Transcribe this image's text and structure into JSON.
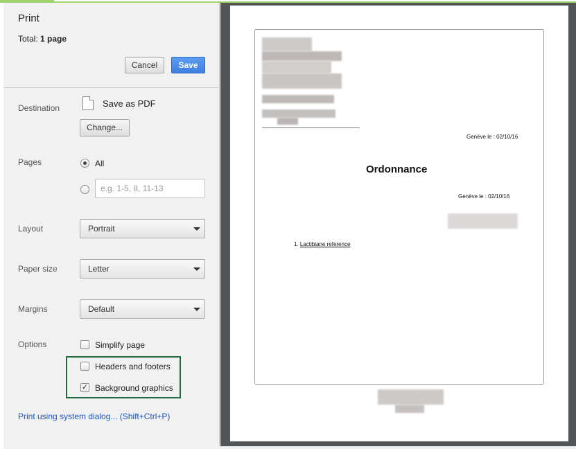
{
  "header": {
    "title": "Print",
    "total_prefix": "Total: ",
    "total_value": "1 page",
    "cancel_label": "Cancel",
    "save_label": "Save"
  },
  "destination": {
    "label": "Destination",
    "name": "Save as PDF",
    "change_label": "Change..."
  },
  "pages": {
    "label": "Pages",
    "all_label": "All",
    "range_placeholder": "e.g. 1-5, 8, 11-13",
    "selected": "All"
  },
  "layout": {
    "label": "Layout",
    "value": "Portrait"
  },
  "paper_size": {
    "label": "Paper size",
    "value": "Letter"
  },
  "margins": {
    "label": "Margins",
    "value": "Default"
  },
  "options": {
    "label": "Options",
    "simplify": {
      "label": "Simplify page",
      "checked": false
    },
    "headers": {
      "label": "Headers and footers",
      "checked": false
    },
    "background": {
      "label": "Background graphics",
      "checked": true
    }
  },
  "system_dialog_link": "Print using system dialog... (Shift+Ctrl+P)",
  "preview": {
    "date_line_1": "Genève le :  02/10/16",
    "heading": "Ordonnance",
    "date_line_2": "Genève le :  02/10/16",
    "item_number": "1.",
    "item_text": "Lactibiane reference"
  },
  "colors": {
    "save_button": "#4285f4",
    "highlight_border": "#216a3b",
    "link": "#1a55c5",
    "preview_background": "#525659"
  }
}
